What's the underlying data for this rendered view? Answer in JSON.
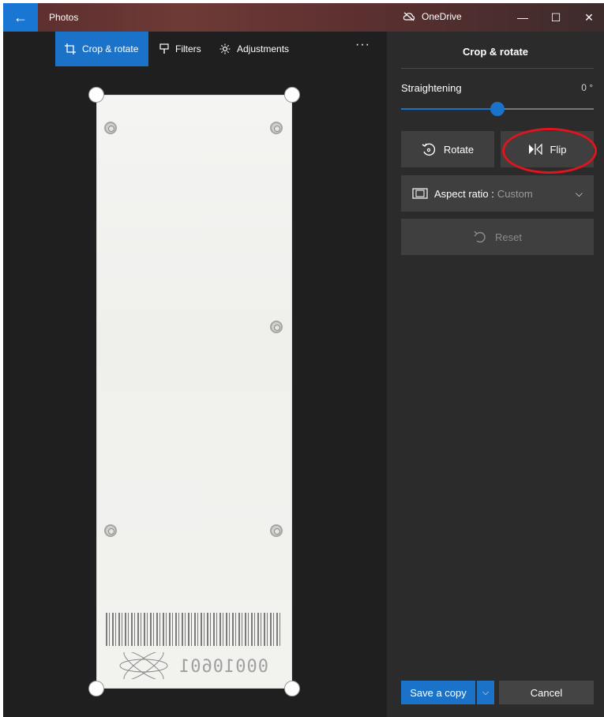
{
  "window": {
    "title": "Photos",
    "back_icon": "arrow-left-icon",
    "onedrive_label": "OneDrive",
    "minimize_symbol": "—",
    "maximize_symbol": "☐",
    "close_symbol": "✕"
  },
  "toolbar": {
    "tabs": [
      {
        "label": "Crop & rotate",
        "icon": "crop-icon",
        "active": true
      },
      {
        "label": "Filters",
        "icon": "brush-icon",
        "active": false
      },
      {
        "label": "Adjustments",
        "icon": "sun-icon",
        "active": false
      }
    ],
    "more_label": "···"
  },
  "photo": {
    "serial_text": "00010601"
  },
  "panel": {
    "title": "Crop & rotate",
    "straightening_label": "Straightening",
    "straightening_value": "0 °",
    "straightening_fraction": 0.5,
    "rotate_label": "Rotate",
    "flip_label": "Flip",
    "aspect_label": "Aspect ratio :",
    "aspect_value": "Custom",
    "reset_label": "Reset",
    "save_label": "Save a copy",
    "cancel_label": "Cancel"
  },
  "colors": {
    "accent": "#1a73c9",
    "highlight_ring": "#e0141f"
  }
}
